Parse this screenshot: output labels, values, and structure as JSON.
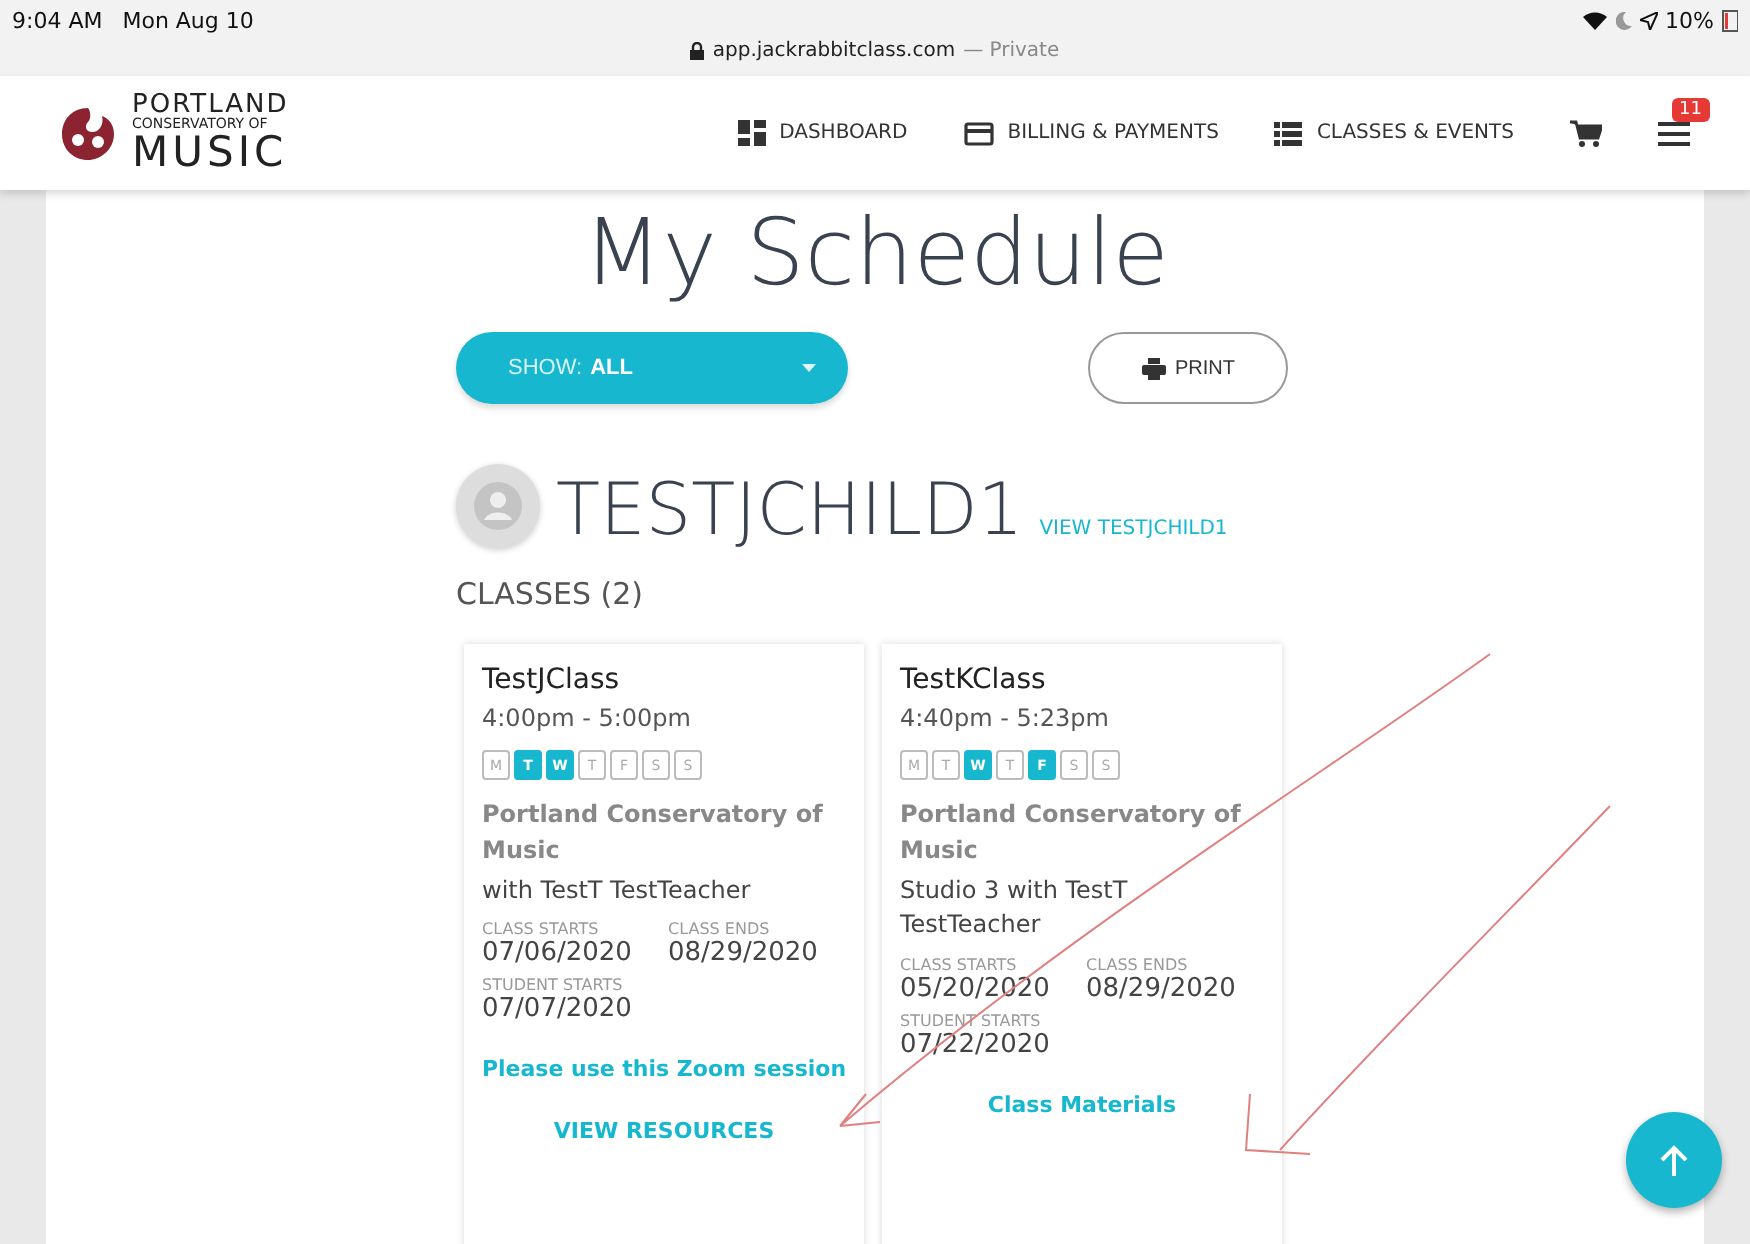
{
  "status_bar": {
    "time": "9:04 AM",
    "date": "Mon Aug 10",
    "url": "app.jackrabbitclass.com",
    "private": "— Private",
    "battery": "10%"
  },
  "brand": {
    "line1": "PORTLAND",
    "line2": "CONSERVATORY OF",
    "line3": "MUSIC"
  },
  "nav": [
    {
      "label": "DASHBOARD",
      "kind": "dashboard"
    },
    {
      "label": "BILLING & PAYMENTS",
      "kind": "billing"
    },
    {
      "label": "CLASSES & EVENTS",
      "kind": "classes"
    }
  ],
  "menu_badge": "11",
  "page_title": "My Schedule",
  "show_filter": {
    "label": "SHOW:",
    "value": "ALL"
  },
  "print_button": "PRINT",
  "student": {
    "name": "TESTJCHILD1",
    "link": "VIEW TESTJCHILD1"
  },
  "classes_heading": "CLASSES (2)",
  "classes": [
    {
      "name": "TestJClass",
      "time": "4:00pm - 5:00pm",
      "days": [
        {
          "label": "M",
          "selected": false
        },
        {
          "label": "T",
          "selected": true
        },
        {
          "label": "W",
          "selected": true
        },
        {
          "label": "T",
          "selected": false
        },
        {
          "label": "F",
          "selected": false
        },
        {
          "label": "S",
          "selected": false
        },
        {
          "label": "S",
          "selected": false
        }
      ],
      "location": "Portland Conservatory of Music",
      "teacher": "with TestT TestTeacher",
      "class_starts_label": "CLASS STARTS",
      "class_starts": "07/06/2020",
      "class_ends_label": "CLASS ENDS",
      "class_ends": "08/29/2020",
      "student_starts_label": "STUDENT STARTS",
      "student_starts": "07/07/2020",
      "links": [
        "Please use this Zoom session",
        "VIEW RESOURCES"
      ]
    },
    {
      "name": "TestKClass",
      "time": "4:40pm - 5:23pm",
      "days": [
        {
          "label": "M",
          "selected": false
        },
        {
          "label": "T",
          "selected": false
        },
        {
          "label": "W",
          "selected": true
        },
        {
          "label": "T",
          "selected": false
        },
        {
          "label": "F",
          "selected": true
        },
        {
          "label": "S",
          "selected": false
        },
        {
          "label": "S",
          "selected": false
        }
      ],
      "location": "Portland Conservatory of Music",
      "teacher": "Studio 3 with TestT TestTeacher",
      "class_starts_label": "CLASS STARTS",
      "class_starts": "05/20/2020",
      "class_ends_label": "CLASS ENDS",
      "class_ends": "08/29/2020",
      "student_starts_label": "STUDENT STARTS",
      "student_starts": "07/22/2020",
      "links": [
        "Class Materials"
      ]
    }
  ]
}
